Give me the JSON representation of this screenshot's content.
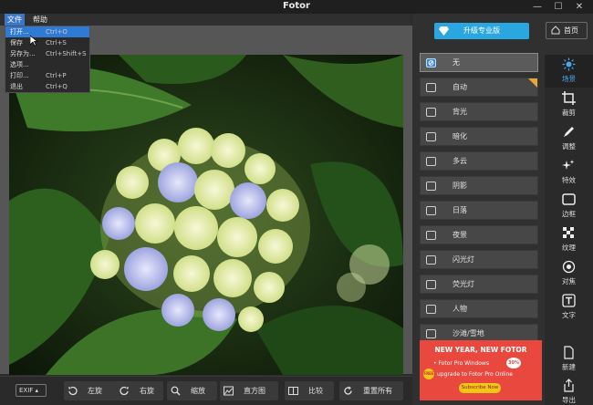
{
  "window": {
    "title": "Fotor",
    "controls": {
      "minimize": "—",
      "maximize": "☐",
      "close": "✕"
    }
  },
  "menubar": {
    "file": "文件",
    "help": "帮助"
  },
  "file_menu": {
    "items": [
      {
        "label": "打开...",
        "shortcut": "Ctrl+O",
        "highlighted": true
      },
      {
        "label": "保存",
        "shortcut": "Ctrl+S"
      },
      {
        "label": "另存为...",
        "shortcut": "Ctrl+Shift+S"
      },
      {
        "label": "选项...",
        "shortcut": ""
      },
      {
        "label": "打印...",
        "shortcut": "Ctrl+P"
      },
      {
        "label": "退出",
        "shortcut": "Ctrl+Q"
      }
    ]
  },
  "bottombar": {
    "exif": "EXIF ▴",
    "buttons": [
      {
        "label": "左旋",
        "icon": "rotate-left-icon"
      },
      {
        "label": "右旋",
        "icon": "rotate-right-icon"
      },
      {
        "label": "缩放",
        "icon": "zoom-icon"
      },
      {
        "label": "直方图",
        "icon": "histogram-icon"
      },
      {
        "label": "比较",
        "icon": "compare-icon"
      },
      {
        "label": "重置所有",
        "icon": "reset-icon"
      }
    ]
  },
  "header": {
    "upgrade": "升级专业版",
    "home": "首页"
  },
  "presets": [
    {
      "label": "无",
      "selected": true
    },
    {
      "label": "自动",
      "star": true
    },
    {
      "label": "背光"
    },
    {
      "label": "暗化"
    },
    {
      "label": "多云"
    },
    {
      "label": "阴影"
    },
    {
      "label": "日落"
    },
    {
      "label": "夜景"
    },
    {
      "label": "闪光灯"
    },
    {
      "label": "荧光灯"
    },
    {
      "label": "人物"
    },
    {
      "label": "沙滩/雪地"
    }
  ],
  "side_tools": [
    {
      "label": "场景",
      "active": true
    },
    {
      "label": "裁剪"
    },
    {
      "label": "调整"
    },
    {
      "label": "特效"
    },
    {
      "label": "边框"
    },
    {
      "label": "纹理"
    },
    {
      "label": "对焦"
    },
    {
      "label": "文字"
    },
    {
      "label": "新建"
    },
    {
      "label": "导出"
    }
  ],
  "ad": {
    "title": "NEW YEAR, NEW FOTOR",
    "line1": "• Fotor Pro Windows",
    "badge": "30% off",
    "free": "FREE",
    "line2": "upgrade to Fotor Pro Online",
    "button": "Subscribe Now"
  },
  "colors": {
    "accent": "#2ba7df",
    "menu_highlight": "#3b77c6",
    "ad_red": "#e8483d"
  }
}
